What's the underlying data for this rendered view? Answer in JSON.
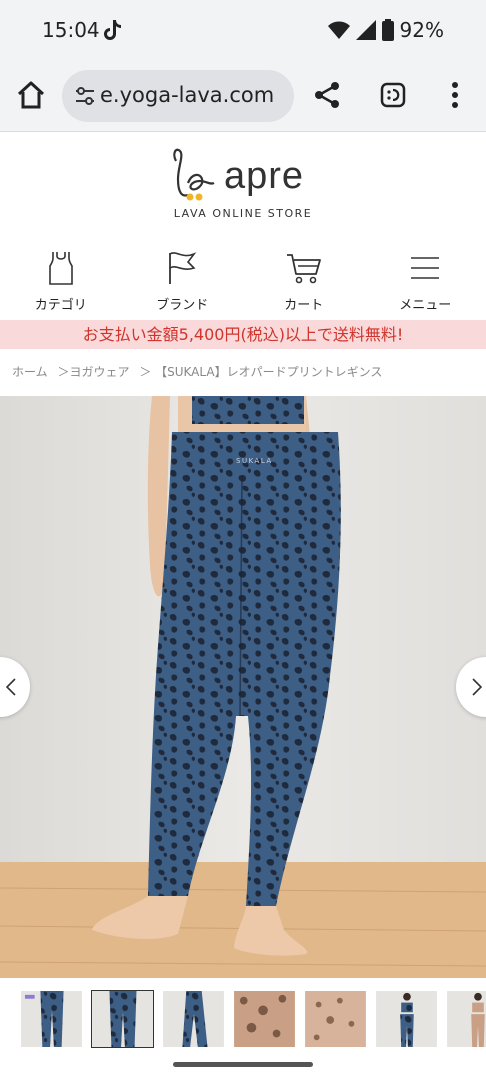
{
  "status_bar": {
    "time": "15:04",
    "battery": "92%",
    "icons": [
      "tiktok-icon",
      "wifi-icon",
      "signal-icon",
      "battery-icon"
    ]
  },
  "browser": {
    "url": "e.yoga-lava.com",
    "icons": [
      "home-icon",
      "tune-icon",
      "share-icon",
      "extension-icon",
      "more-vert-icon"
    ]
  },
  "logo": {
    "word": "apre",
    "subtitle": "LAVA ONLINE STORE"
  },
  "nav": {
    "items": [
      {
        "label": "カテゴリ",
        "icon": "tank-top-icon"
      },
      {
        "label": "ブランド",
        "icon": "flag-icon"
      },
      {
        "label": "カート",
        "icon": "cart-icon"
      },
      {
        "label": "メニュー",
        "icon": "menu-icon"
      }
    ]
  },
  "banner": {
    "text": "お支払い金額5,400円(税込)以上で送料無料!"
  },
  "breadcrumb": {
    "items": [
      "ホーム",
      "＞ヨガウェア",
      "＞ 【SUKALA】レオパードプリントレギンス"
    ]
  },
  "product": {
    "waistband_text": "SUKALA",
    "image_icon": "leggings-photo",
    "thumbnail_count": 7,
    "active_thumbnail": 2
  },
  "colors": {
    "banner_bg": "#f9d9d9",
    "banner_text": "#d0342c",
    "legging_blue": "#3d5e85",
    "legging_dark": "#1f2a3d",
    "floor": "#e0b88a",
    "wall": "#e8e6e3"
  }
}
